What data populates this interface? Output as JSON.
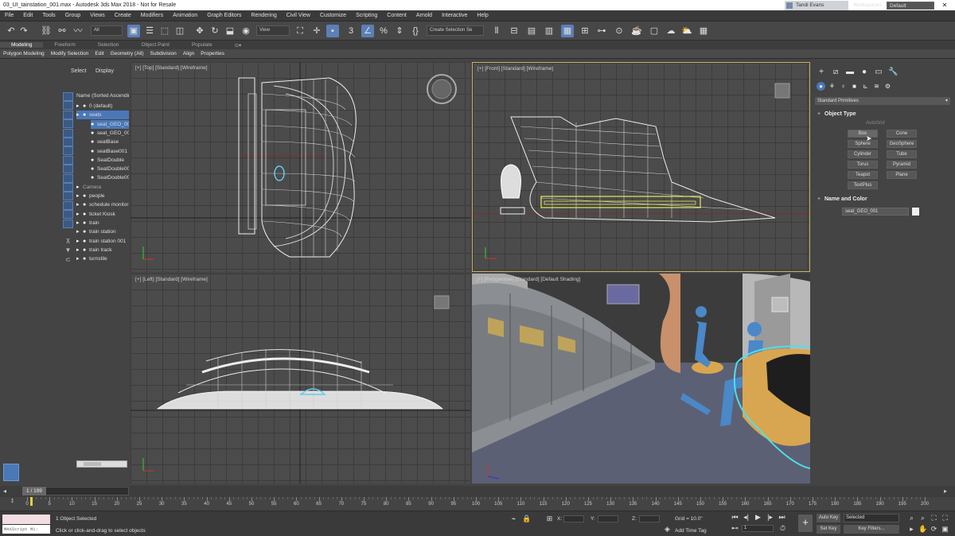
{
  "window": {
    "title": "03_UI_tainstation_001.max - Autodesk 3ds Max 2018 - Not for Resale",
    "controls": [
      "—",
      "❐",
      "✕"
    ]
  },
  "menu": [
    "File",
    "Edit",
    "Tools",
    "Group",
    "Views",
    "Create",
    "Modifiers",
    "Animation",
    "Graph Editors",
    "Rendering",
    "Civil View",
    "Customize",
    "Scripting",
    "Content",
    "Arnold",
    "Interactive",
    "Help"
  ],
  "user": {
    "name": "Tandi Evans"
  },
  "workspaces": {
    "label": "Workspaces:",
    "value": "Default"
  },
  "toolbar": {
    "filter_value": "All",
    "coord_value": "View",
    "selection_set_placeholder": "Create Selection Se"
  },
  "ribbon": {
    "tabs": [
      "Modeling",
      "Freeform",
      "Selection",
      "Object Paint",
      "Populate"
    ],
    "active_tab": "Modeling",
    "items": [
      "Polygon Modeling",
      "Modify Selection",
      "Edit",
      "Geometry (All)",
      "Subdivision",
      "Align",
      "Properties"
    ]
  },
  "scene_explorer": {
    "tabs": [
      "Select",
      "Display"
    ],
    "column_header": "Name (Sorted Ascending)",
    "rows": [
      {
        "label": "0 (default)",
        "level": 1,
        "icons": "eye"
      },
      {
        "label": "seats",
        "level": 1,
        "selected": true,
        "icons": "eye"
      },
      {
        "label": "seat_GEO_001",
        "level": 2,
        "selected": true,
        "icons": "eye"
      },
      {
        "label": "seat_GEO_002",
        "level": 2,
        "icons": "eye"
      },
      {
        "label": "seatBase",
        "level": 2,
        "icons": "eye"
      },
      {
        "label": "seatBase001",
        "level": 2,
        "icons": "eye"
      },
      {
        "label": "SeatDouble",
        "level": 2,
        "icons": "eye"
      },
      {
        "label": "SeatDouble001",
        "level": 2,
        "icons": "eye"
      },
      {
        "label": "SeatDouble002",
        "level": 2,
        "icons": "eye"
      },
      {
        "label": "Camera",
        "level": 1,
        "icons": "none"
      },
      {
        "label": "people",
        "level": 1,
        "icons": "eye"
      },
      {
        "label": "schedule monitor",
        "level": 1,
        "icons": "eye"
      },
      {
        "label": "ticket Kiosk",
        "level": 1,
        "icons": "eye"
      },
      {
        "label": "train",
        "level": 1,
        "icons": "eye"
      },
      {
        "label": "train station",
        "level": 1,
        "icons": "eye"
      },
      {
        "label": "train station 001",
        "level": 1,
        "icons": "eye"
      },
      {
        "label": "train track",
        "level": 1,
        "icons": "eye"
      },
      {
        "label": "turnstile",
        "level": 1,
        "icons": "eye"
      }
    ]
  },
  "viewports": {
    "top": "[+] [Top] [Standard] [Wireframe]",
    "front": "[+] [Front] [Standard] [Wireframe]",
    "left": "[+] [Left] [Standard] [Wireframe]",
    "perspective": "[+] [Perspective] [Standard] [Default Shading]"
  },
  "command_panel": {
    "category": "Standard Primitives",
    "object_type_header": "Object Type",
    "autogrid": "AutoGrid",
    "buttons": [
      "Box",
      "Cone",
      "Sphere",
      "GeoSphere",
      "Cylinder",
      "Tube",
      "Torus",
      "Pyramid",
      "Teapot",
      "Plane",
      "TextPlus"
    ],
    "name_color_header": "Name and Color",
    "object_name": "seat_GEO_001"
  },
  "time": {
    "frame_label": "1 / 199",
    "ticks": [
      "0",
      "5",
      "10",
      "15",
      "20",
      "25",
      "30",
      "35",
      "40",
      "45",
      "50",
      "55",
      "60",
      "65",
      "70",
      "75",
      "80",
      "85",
      "90",
      "95",
      "100",
      "105",
      "110",
      "115",
      "120",
      "125",
      "130",
      "135",
      "140",
      "145",
      "150",
      "155",
      "160",
      "165",
      "170",
      "175",
      "180",
      "185",
      "190",
      "195",
      "200"
    ],
    "current_frame": 1,
    "total_frames": 199
  },
  "status": {
    "maxscript": "MAXScript Mi:",
    "selection": "1 Object Selected",
    "prompt": "Click or click-and-drag to select objects",
    "x_label": "X:",
    "y_label": "Y:",
    "z_label": "Z:",
    "grid": "Grid = 10.0\"",
    "add_time_tag": "Add Time Tag",
    "auto_key": "Auto Key",
    "set_key": "Set Key",
    "key_mode": "Selected",
    "key_filters": "Key Filters...",
    "frame_value": "1"
  },
  "colors": {
    "accent": "#4a78b7",
    "wireframe": "#ffffff",
    "selected_wire": "#e8e85a",
    "viewport_active_border": "#c8b060"
  }
}
